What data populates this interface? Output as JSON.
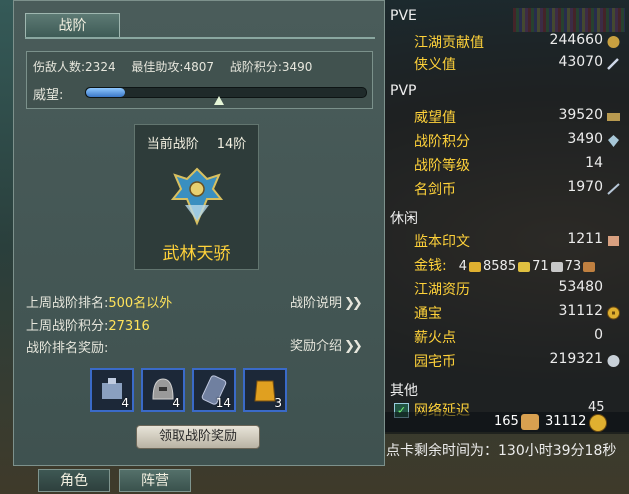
{
  "panel": {
    "tab_label": "战阶",
    "stats": {
      "kills_label": "伤敌人数:",
      "kills": "2324",
      "assist_label": "最佳助攻:",
      "assist": "4807",
      "points_label": "战阶积分:",
      "points": "3490"
    },
    "reputation_label": "威望:",
    "reputation_fill": 0.14,
    "reputation_marker": 0.48,
    "rank": {
      "head_label": "当前战阶",
      "level": "14阶",
      "title": "武林天骄"
    },
    "last_week_rank_label": "上周战阶排名:",
    "last_week_rank": "500名以外",
    "last_week_points_label": "上周战阶积分:",
    "last_week_points": "27316",
    "reward_label": "战阶排名奖励:",
    "link_explain": "战阶说明",
    "link_reward": "奖励介绍",
    "items": [
      {
        "name": "item-1",
        "count": "4",
        "color": "#8aa0c0"
      },
      {
        "name": "item-2",
        "count": "4",
        "color": "#9a9a9a"
      },
      {
        "name": "item-3",
        "count": "14",
        "color": "#7080a0"
      },
      {
        "name": "item-4",
        "count": "3",
        "color": "#e0a020"
      }
    ],
    "claim_button": "领取战阶奖励",
    "bottom_tabs": [
      "角色",
      "阵营"
    ]
  },
  "right": {
    "pve_label": "PVE",
    "pve": [
      {
        "label": "江湖贡献值",
        "value": "244660"
      },
      {
        "label": "侠义值",
        "value": "43070"
      }
    ],
    "pvp_label": "PVP",
    "pvp": [
      {
        "label": "威望值",
        "value": "39520"
      },
      {
        "label": "战阶积分",
        "value": "3490"
      },
      {
        "label": "战阶等级",
        "value": "14"
      },
      {
        "label": "名剑币",
        "value": "1970"
      }
    ],
    "leisure_label": "休闲",
    "leisure_a": [
      {
        "label": "监本印文",
        "value": "1211"
      }
    ],
    "money_label": "金钱:",
    "money": {
      "a": "4",
      "b": "8585",
      "c": "71",
      "d": "73"
    },
    "leisure_b": [
      {
        "label": "江湖资历",
        "value": "53480"
      },
      {
        "label": "通宝",
        "value": "31112"
      },
      {
        "label": "薪火点",
        "value": "0"
      },
      {
        "label": "园宅币",
        "value": "219321"
      }
    ],
    "other_label": "其他",
    "net_label": "网络延迟",
    "net_value": "45"
  },
  "hud": {
    "count_a": "165",
    "count_b": "31112",
    "timer": "点卡剩余时间为：130小时39分18秒"
  },
  "colors": {
    "gold": "#ffd23a",
    "panel": "#4a5c5a",
    "accent_blue": "#3a6ac8"
  }
}
